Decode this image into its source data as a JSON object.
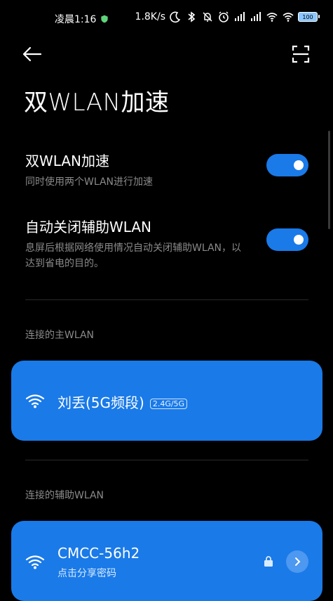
{
  "status_bar": {
    "time": "凌晨1:16",
    "network_speed": "1.8K/s",
    "battery": "100"
  },
  "header": {
    "title": "双WLAN加速"
  },
  "settings": [
    {
      "title": "双WLAN加速",
      "subtitle": "同时使用两个WLAN进行加速",
      "enabled": true
    },
    {
      "title": "自动关闭辅助WLAN",
      "subtitle": "息屏后根据网络使用情况自动关闭辅助WLAN，以达到省电的目的。",
      "enabled": true
    }
  ],
  "primary_section": {
    "label": "连接的主WLAN",
    "network": {
      "name": "刘丢(5G频段)",
      "band": "2.4G/5G"
    }
  },
  "secondary_section": {
    "label": "连接的辅助WLAN",
    "network": {
      "name": "CMCC-56h2",
      "subtitle": "点击分享密码"
    }
  },
  "colors": {
    "accent": "#1a7ae8",
    "background": "#000000",
    "secondary_text": "#8a8a8a"
  }
}
